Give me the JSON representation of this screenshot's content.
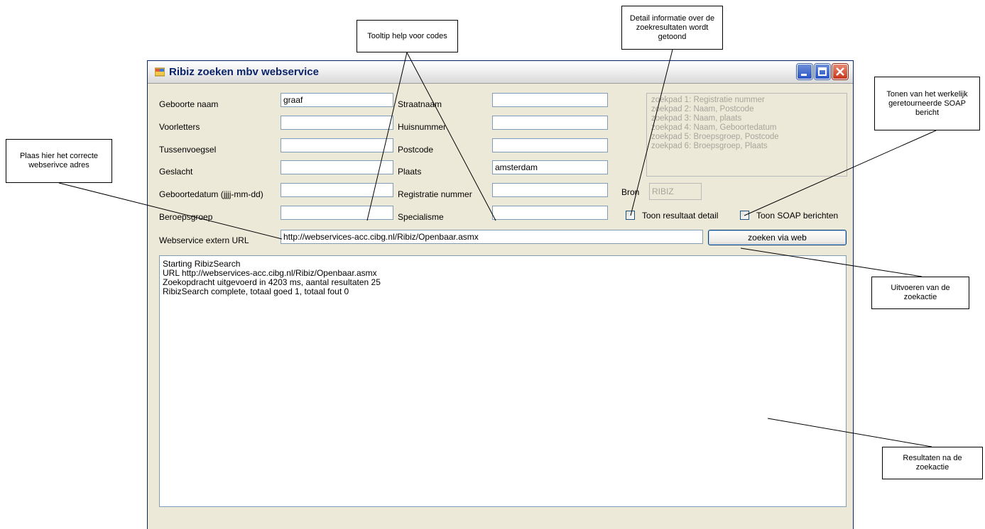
{
  "window": {
    "title": "Ribiz zoeken mbv webservice"
  },
  "form": {
    "left_labels": [
      "Geboorte naam",
      "Voorletters",
      "Tussenvoegsel",
      "Geslacht",
      "Geboortedatum (jjjj-mm-dd)",
      "Beroepsgroep"
    ],
    "left_values": [
      "graaf",
      "",
      "",
      "",
      "",
      ""
    ],
    "mid_labels": [
      "Straatnaam",
      "Huisnummer",
      "Postcode",
      "Plaats",
      "Registratie nummer",
      "Specialisme"
    ],
    "mid_values": [
      "",
      "",
      "",
      "amsterdam",
      "",
      ""
    ],
    "url_label": "Webservice extern URL",
    "url_value": "http://webservices-acc.cibg.nl/Ribiz/Openbaar.asmx",
    "search_button": "zoeken via web"
  },
  "zoekpaden": [
    "zoekpad 1: Registratie nummer",
    "zoekpad 2: Naam, Postcode",
    "zoekpad 3: Naam, plaats",
    "zoekpad 4: Naam, Geboortedatum",
    "zoekpad 5: Broepsgroep, Postcode",
    "zoekpad 6: Broepsgroep, Plaats"
  ],
  "bron": {
    "label": "Bron",
    "value": "RIBIZ"
  },
  "checkboxes": {
    "detail_label": "Toon resultaat detail",
    "detail_checked": false,
    "soap_label": "Toon SOAP berichten",
    "soap_checked": false
  },
  "output_lines": [
    "Starting RibizSearch",
    "URL http://webservices-acc.cibg.nl/Ribiz/Openbaar.asmx",
    "Zoekopdracht uitgevoerd in 4203 ms, aantal resultaten 25",
    "RibizSearch complete, totaal goed 1, totaal fout 0"
  ],
  "callouts": {
    "tooltip": "Tooltip help voor codes",
    "detail": "Detail informatie over de zoekresultaten wordt getoond",
    "soap": "Tonen van het werkelijk geretourneerde SOAP bericht",
    "url": "Plaas hier het correcte webserivce adres",
    "uitvoeren": "Uitvoeren van de zoekactie",
    "resultaten": "Resultaten na de zoekactie"
  }
}
